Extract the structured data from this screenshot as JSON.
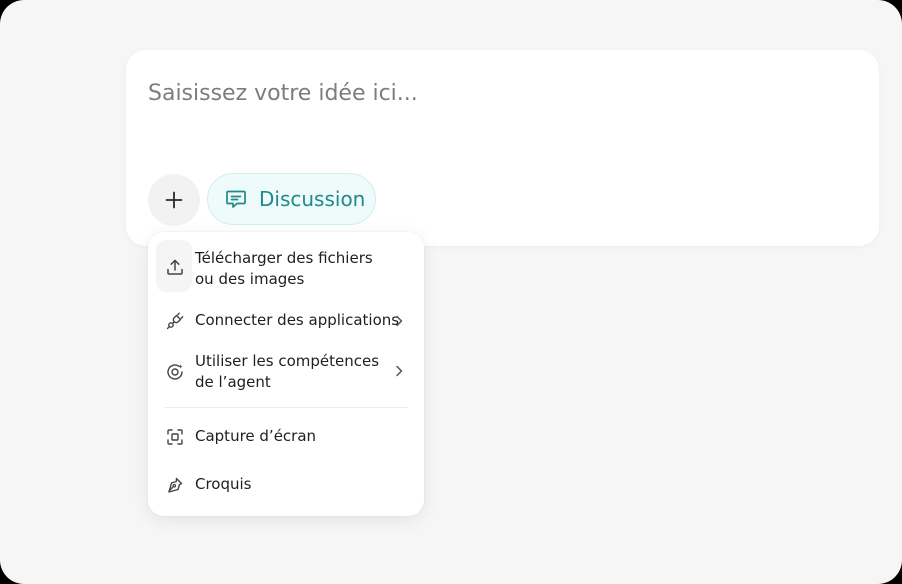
{
  "composer": {
    "placeholder": "Saisissez votre idée ici...",
    "mode_chip_label": "Discussion"
  },
  "menu": {
    "items": [
      {
        "label_line1": "Télécharger des fichiers",
        "label_line2": "ou des images",
        "icon": "upload-icon",
        "has_submenu": false
      },
      {
        "label_line1": "Connecter des applications",
        "label_line2": "",
        "icon": "plug-icon",
        "has_submenu": true
      },
      {
        "label_line1": "Utiliser les compétences",
        "label_line2": "de l’agent",
        "icon": "agent-skills-icon",
        "has_submenu": true
      },
      {
        "label_line1": "Capture d’écran",
        "label_line2": "",
        "icon": "screenshot-icon",
        "has_submenu": false
      },
      {
        "label_line1": "Croquis",
        "label_line2": "",
        "icon": "pen-icon",
        "has_submenu": false
      }
    ]
  },
  "colors": {
    "background": "#f6f6f6",
    "card": "#ffffff",
    "accent": "#1d8b8b",
    "chip_bg": "#effafa",
    "text": "#1f1f1f",
    "placeholder": "#7d7d7d"
  }
}
